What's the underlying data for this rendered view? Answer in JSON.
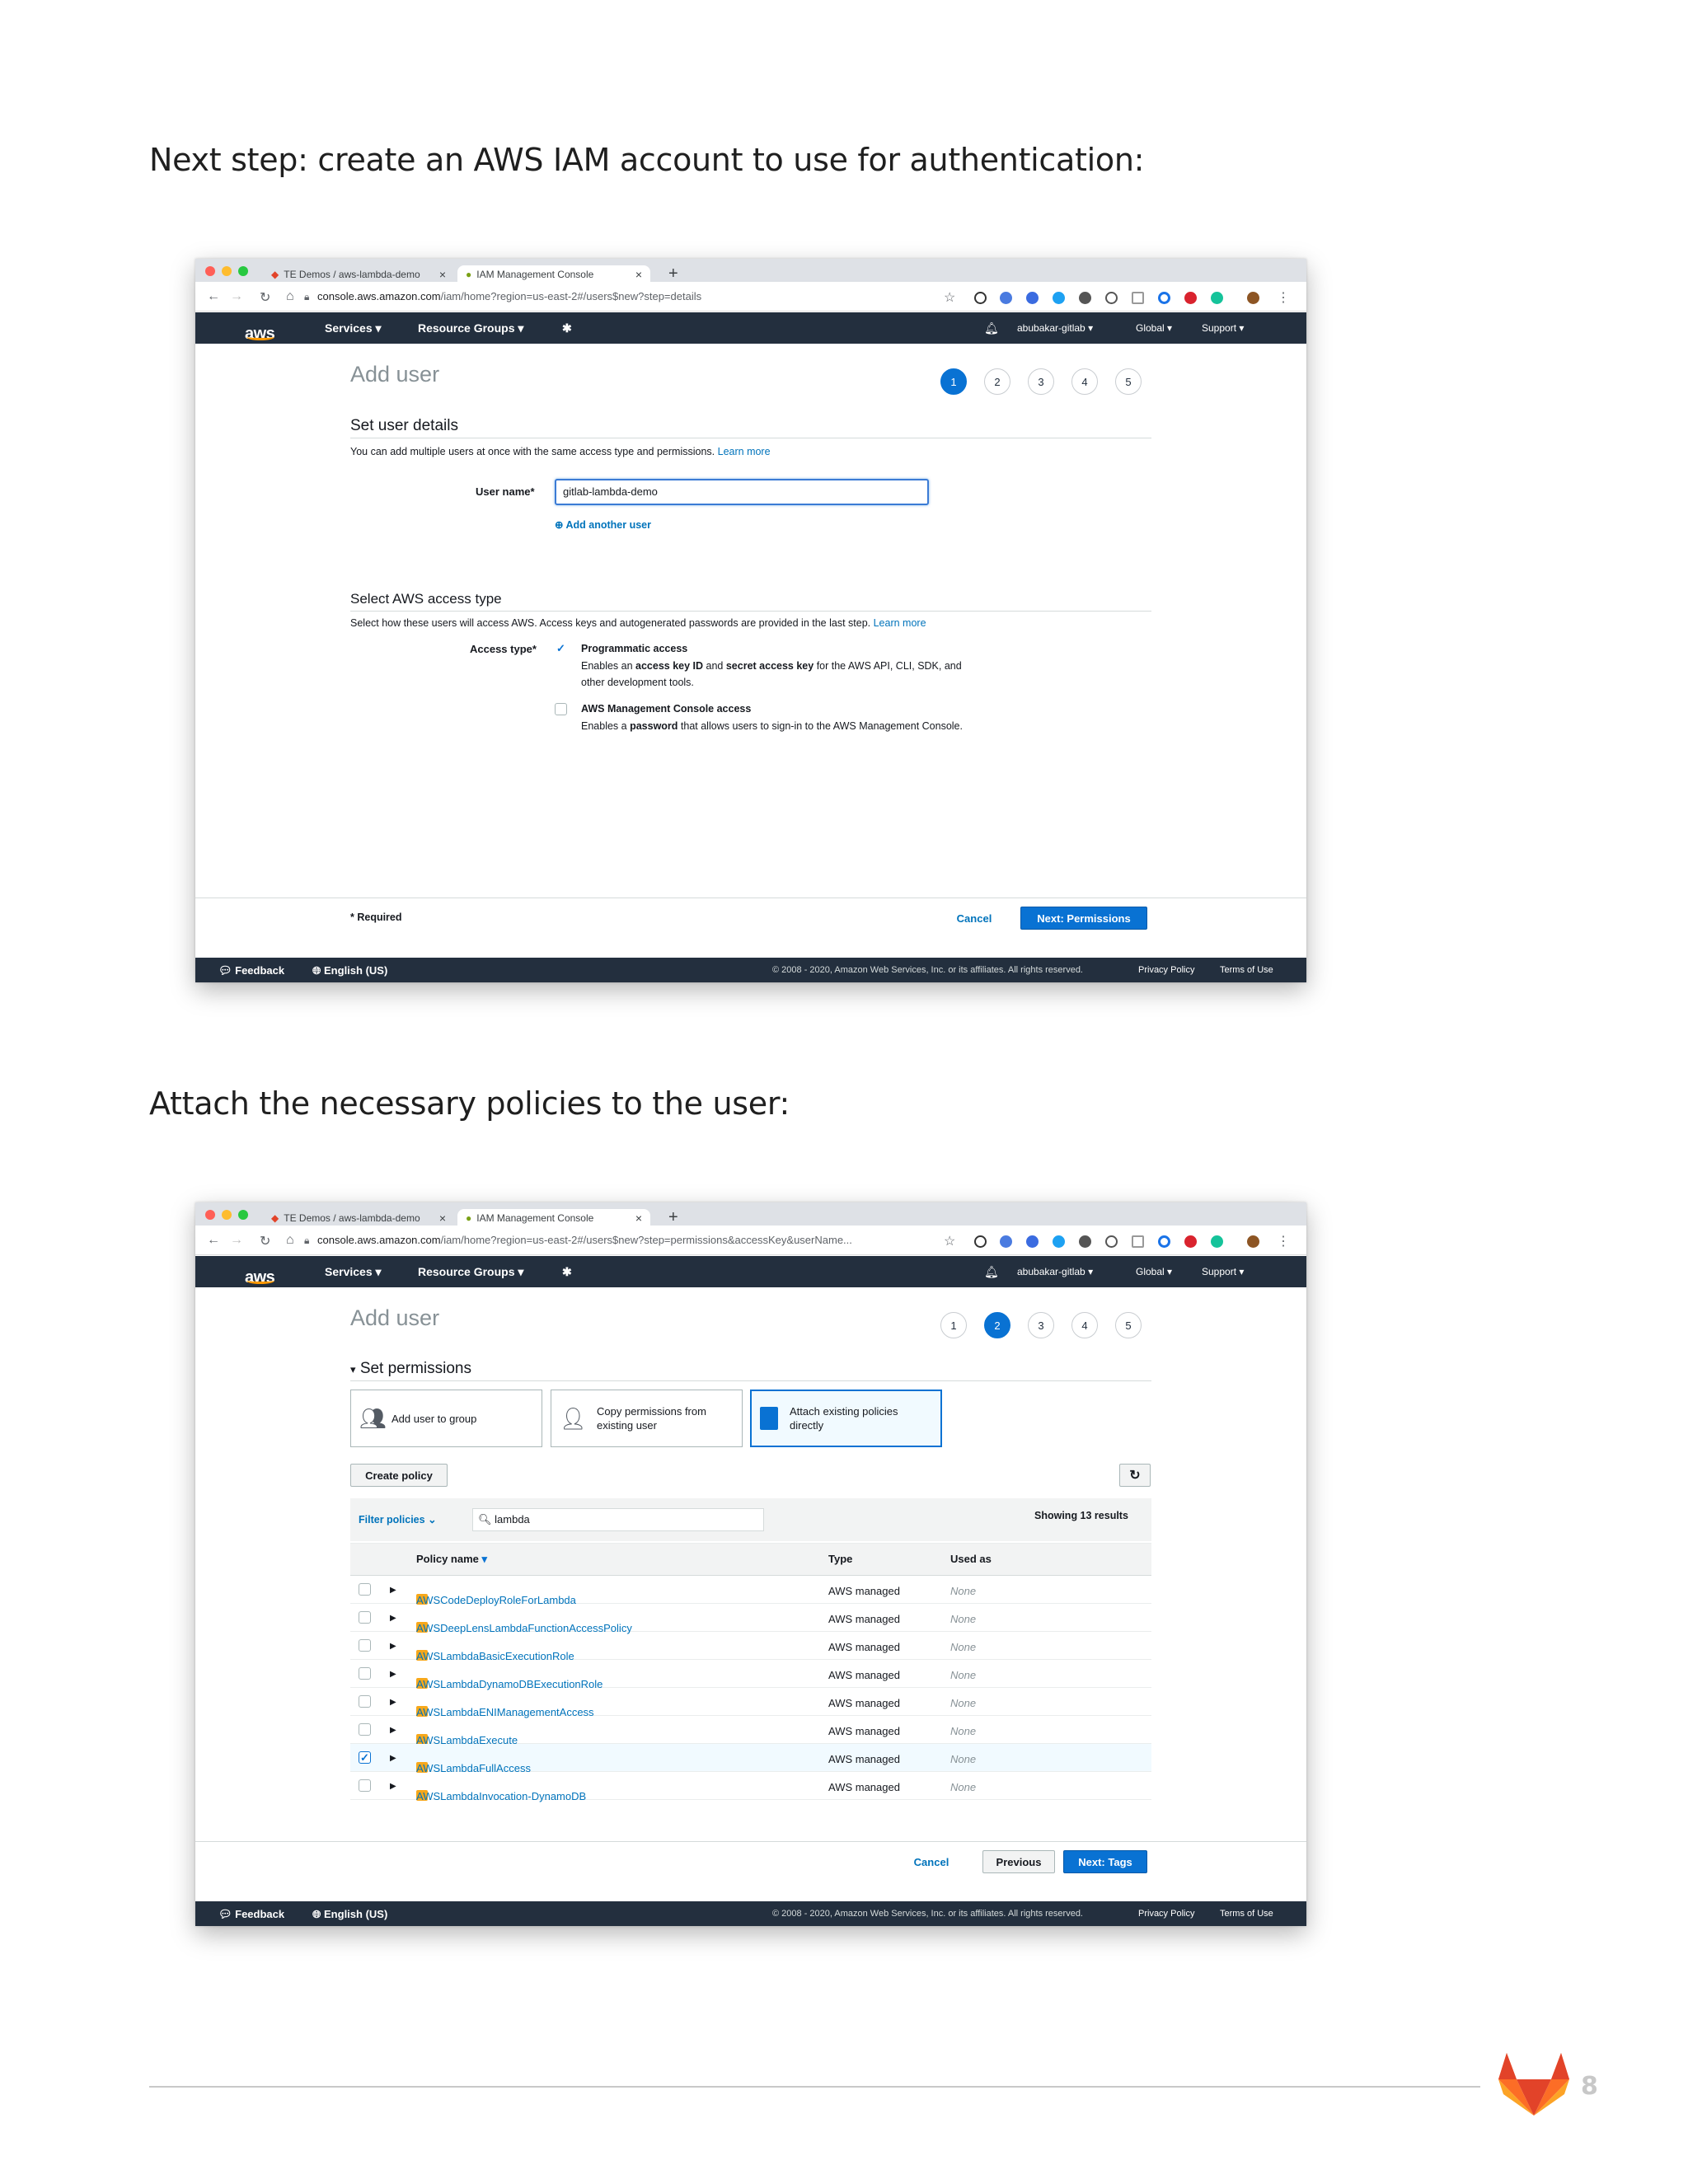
{
  "headings": {
    "first": "Next step: create an AWS IAM account to use for authentication:",
    "second": "Attach the necessary policies to the user:"
  },
  "browser": {
    "tab1": "TE Demos / aws-lambda-demo",
    "tab2": "IAM Management Console",
    "url_host": "console.aws.amazon.com",
    "url1_path": "/iam/home?region=us-east-2#/users$new?step=details",
    "url2_path": "/iam/home?region=us-east-2#/users$new?step=permissions&accessKey&userName..."
  },
  "awsnav": {
    "logo": "aws",
    "services": "Services",
    "resource_groups": "Resource Groups",
    "account": "abubakar-gitlab",
    "region": "Global",
    "support": "Support"
  },
  "wizard": {
    "title": "Add user",
    "steps": [
      "1",
      "2",
      "3",
      "4",
      "5"
    ]
  },
  "screen1": {
    "set_user_details": "Set user details",
    "set_user_desc": "You can add multiple users at once with the same access type and permissions.",
    "learn_more": "Learn more",
    "user_name_label": "User name*",
    "user_name_value": "gitlab-lambda-demo",
    "add_another_user": "Add another user",
    "access_type_title": "Select AWS access type",
    "access_type_desc": "Select how these users will access AWS. Access keys and autogenerated passwords are provided in the last step.",
    "access_type_label": "Access type*",
    "prog_title": "Programmatic access",
    "prog_desc_a": "Enables an ",
    "prog_desc_b": "access key ID",
    "prog_desc_c": " and ",
    "prog_desc_d": "secret access key",
    "prog_desc_e": " for the AWS API, CLI, SDK, and",
    "prog_desc_f": "other development tools.",
    "console_title": "AWS Management Console access",
    "console_desc_a": "Enables a ",
    "console_desc_b": "password",
    "console_desc_c": " that allows users to sign-in to the AWS Management Console.",
    "required": "* Required",
    "cancel": "Cancel",
    "next": "Next: Permissions"
  },
  "screen2": {
    "set_permissions": "Set permissions",
    "card_group": "Add user to group",
    "card_copy_1": "Copy permissions from",
    "card_copy_2": "existing user",
    "card_attach_1": "Attach existing policies",
    "card_attach_2": "directly",
    "create_policy": "Create policy",
    "filter_policies": "Filter policies",
    "search_value": "lambda",
    "showing": "Showing 13 results",
    "col_policy": "Policy name",
    "col_type": "Type",
    "col_used": "Used as",
    "rows": [
      {
        "name": "AWSCodeDeployRoleForLambda",
        "type": "AWS managed",
        "used": "None",
        "checked": false
      },
      {
        "name": "AWSDeepLensLambdaFunctionAccessPolicy",
        "type": "AWS managed",
        "used": "None",
        "checked": false
      },
      {
        "name": "AWSLambdaBasicExecutionRole",
        "type": "AWS managed",
        "used": "None",
        "checked": false
      },
      {
        "name": "AWSLambdaDynamoDBExecutionRole",
        "type": "AWS managed",
        "used": "None",
        "checked": false
      },
      {
        "name": "AWSLambdaENIManagementAccess",
        "type": "AWS managed",
        "used": "None",
        "checked": false
      },
      {
        "name": "AWSLambdaExecute",
        "type": "AWS managed",
        "used": "None",
        "checked": false
      },
      {
        "name": "AWSLambdaFullAccess",
        "type": "AWS managed",
        "used": "None",
        "checked": true
      },
      {
        "name": "AWSLambdaInvocation-DynamoDB",
        "type": "AWS managed",
        "used": "None",
        "checked": false
      }
    ],
    "cancel": "Cancel",
    "previous": "Previous",
    "next": "Next: Tags"
  },
  "footer": {
    "feedback": "Feedback",
    "language": "English (US)",
    "copyright": "© 2008 - 2020, Amazon Web Services, Inc. or its affiliates. All rights reserved.",
    "privacy": "Privacy Policy",
    "terms": "Terms of Use"
  },
  "page_number": "8",
  "colors": {
    "aws_nav": "#232f3e",
    "aws_blue": "#0972d3",
    "aws_orange": "#ff9900"
  }
}
